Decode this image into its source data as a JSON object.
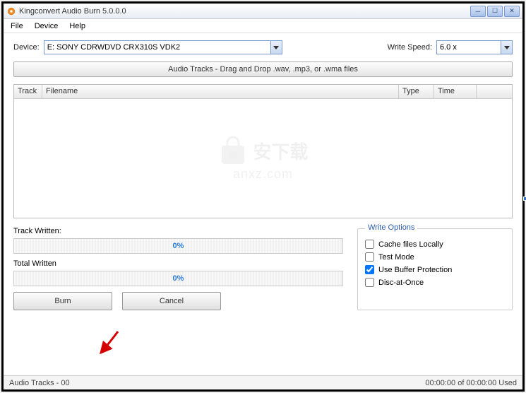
{
  "window": {
    "title": "Kingconvert Audio Burn 5.0.0.0"
  },
  "menu": {
    "file": "File",
    "device": "Device",
    "help": "Help"
  },
  "controls": {
    "device_label": "Device:",
    "device_value": "E: SONY CDRWDVD CRX310S VDK2",
    "writespeed_label": "Write Speed:",
    "writespeed_value": "6.0 x",
    "drop_header": "Audio Tracks - Drag and Drop .wav, .mp3, or .wma files"
  },
  "table": {
    "headers": {
      "track": "Track",
      "filename": "Filename",
      "type": "Type",
      "time": "Time"
    }
  },
  "watermark": {
    "cn": "安下载",
    "en": "anxz.com"
  },
  "progress": {
    "track_label": "Track Written:",
    "track_pct": "0%",
    "total_label": "Total Written",
    "total_pct": "0%"
  },
  "buttons": {
    "burn": "Burn",
    "cancel": "Cancel"
  },
  "options": {
    "legend": "Write Options",
    "cache": "Cache files Locally",
    "cache_checked": false,
    "test": "Test Mode",
    "test_checked": false,
    "buffer": "Use Buffer Protection",
    "buffer_checked": true,
    "dao": "Disc-at-Once",
    "dao_checked": false
  },
  "status": {
    "left": "Audio Tracks - 00",
    "right": "00:00:00 of 00:00:00 Used"
  }
}
